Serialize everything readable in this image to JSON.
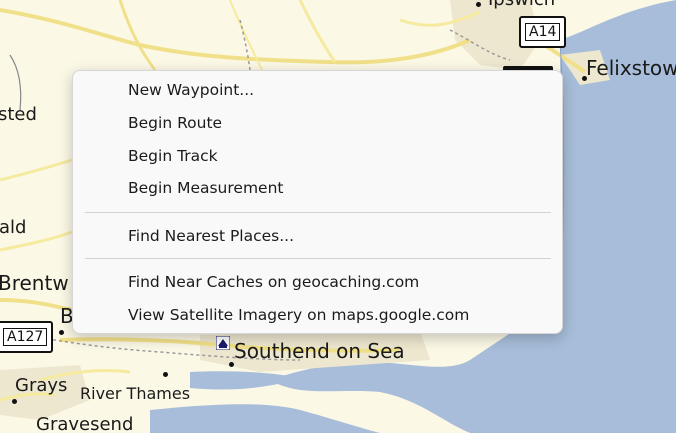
{
  "map": {
    "labels": {
      "ipswich_partial": "Ipswich",
      "felixstowe": "Felixstowe",
      "halstead_partial": "sted",
      "witham_partial": "ald",
      "brentwood_partial": "Brentw",
      "billericay_partial": "B",
      "southend": "Southend on Sea",
      "grays": "Grays",
      "river_thames": "River Thames",
      "gravesend": "Gravesend"
    },
    "road_shields": {
      "a14": "A14",
      "a127": "A127"
    },
    "colors": {
      "land": "#fbf8e6",
      "sea": "#a7bdd9",
      "road_major": "#f3e38a",
      "road_minor": "#fff4b0",
      "urban": "#e6e1cf"
    }
  },
  "context_menu": {
    "items": [
      {
        "label": "New Waypoint..."
      },
      {
        "label": "Begin Route"
      },
      {
        "label": "Begin Track"
      },
      {
        "label": "Begin Measurement"
      },
      {
        "label": "Find Nearest Places..."
      },
      {
        "label": "Find Near Caches on geocaching.com"
      },
      {
        "label": "View Satellite Imagery on maps.google.com"
      }
    ]
  }
}
